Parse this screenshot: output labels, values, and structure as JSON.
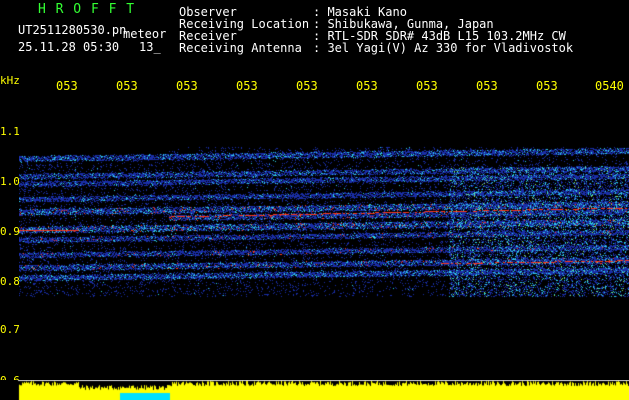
{
  "header": {
    "logo": "H R O F F T",
    "filename": "UT2511280530.pn",
    "suffix": "meteor",
    "datetime": "25.11.28 05:30",
    "count": "13_",
    "info": [
      {
        "label": "Observer",
        "value": ": Masaki Kano"
      },
      {
        "label": "Receiving Location",
        "value": ": Shibukawa, Gunma, Japan"
      },
      {
        "label": "Receiver",
        "value": ": RTL-SDR SDR# 43dB L15 103.2MHz CW"
      },
      {
        "label": "Receiving Antenna",
        "value": ": 3el Yagi(V) Az 330 for Vladivostok"
      }
    ]
  },
  "axis": {
    "unit": "kHz",
    "y_labels": [
      "1.1",
      "1.0",
      "0.9",
      "0.8",
      "0.7",
      "0.6"
    ],
    "x_labels": [
      "053",
      "053",
      "053",
      "053",
      "053",
      "053",
      "053",
      "053",
      "053",
      "0540"
    ]
  },
  "colors": {
    "background": "#000000",
    "label_yellow": "#ffff00",
    "label_green": "#33ff33",
    "label_white": "#ffffff",
    "signal_low": "#1a2ea8",
    "signal_mid": "#2fd0e8",
    "signal_high": "#ff3a1a",
    "bar_yellow": "#ffff00",
    "bar_cyan": "#00e0ff"
  }
}
